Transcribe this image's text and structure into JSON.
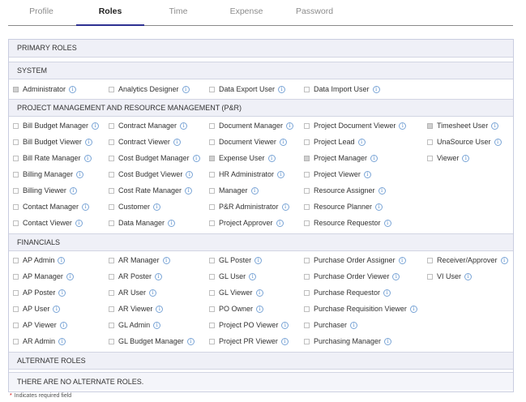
{
  "tabs": [
    "Profile",
    "Roles",
    "Time",
    "Expense",
    "Password"
  ],
  "active_tab": "Roles",
  "info_glyph": "i",
  "sections": {
    "primary_roles": "PRIMARY ROLES",
    "system": "SYSTEM",
    "pmrm": "PROJECT MANAGEMENT AND RESOURCE MANAGEMENT (P&R)",
    "financials": "FINANCIALS",
    "alternate_roles": "ALTERNATE ROLES",
    "no_alternate": "THERE ARE NO ALTERNATE ROLES."
  },
  "system_roles": [
    {
      "label": "Administrator",
      "checked": true
    },
    {
      "label": "Analytics Designer",
      "checked": false
    },
    {
      "label": "Data Export User",
      "checked": false
    },
    {
      "label": "Data Import User",
      "checked": false
    }
  ],
  "pmrm_columns": [
    [
      {
        "label": "Bill Budget Manager",
        "checked": false
      },
      {
        "label": "Bill Budget Viewer",
        "checked": false
      },
      {
        "label": "Bill Rate Manager",
        "checked": false
      },
      {
        "label": "Billing Manager",
        "checked": false
      },
      {
        "label": "Billing Viewer",
        "checked": false
      },
      {
        "label": "Contact Manager",
        "checked": false
      },
      {
        "label": "Contact Viewer",
        "checked": false
      }
    ],
    [
      {
        "label": "Contract Manager",
        "checked": false
      },
      {
        "label": "Contract Viewer",
        "checked": false
      },
      {
        "label": "Cost Budget Manager",
        "checked": false
      },
      {
        "label": "Cost Budget Viewer",
        "checked": false
      },
      {
        "label": "Cost Rate Manager",
        "checked": false
      },
      {
        "label": "Customer",
        "checked": false
      },
      {
        "label": "Data Manager",
        "checked": false
      }
    ],
    [
      {
        "label": "Document Manager",
        "checked": false
      },
      {
        "label": "Document Viewer",
        "checked": false
      },
      {
        "label": "Expense User",
        "checked": true
      },
      {
        "label": "HR Administrator",
        "checked": false
      },
      {
        "label": "Manager",
        "checked": false
      },
      {
        "label": "P&R Administrator",
        "checked": false
      },
      {
        "label": "Project Approver",
        "checked": false
      }
    ],
    [
      {
        "label": "Project Document Viewer",
        "checked": false
      },
      {
        "label": "Project Lead",
        "checked": false
      },
      {
        "label": "Project Manager",
        "checked": true
      },
      {
        "label": "Project Viewer",
        "checked": false
      },
      {
        "label": "Resource Assigner",
        "checked": false
      },
      {
        "label": "Resource Planner",
        "checked": false
      },
      {
        "label": "Resource Requestor",
        "checked": false
      }
    ],
    [
      {
        "label": "Timesheet User",
        "checked": true
      },
      {
        "label": "UnaSource User",
        "checked": false
      },
      {
        "label": "Viewer",
        "checked": false
      }
    ]
  ],
  "financial_columns": [
    [
      {
        "label": "AP Admin",
        "checked": false
      },
      {
        "label": "AP Manager",
        "checked": false
      },
      {
        "label": "AP Poster",
        "checked": false
      },
      {
        "label": "AP User",
        "checked": false
      },
      {
        "label": "AP Viewer",
        "checked": false
      },
      {
        "label": "AR Admin",
        "checked": false
      }
    ],
    [
      {
        "label": "AR Manager",
        "checked": false
      },
      {
        "label": "AR Poster",
        "checked": false
      },
      {
        "label": "AR User",
        "checked": false
      },
      {
        "label": "AR Viewer",
        "checked": false
      },
      {
        "label": "GL Admin",
        "checked": false
      },
      {
        "label": "GL Budget Manager",
        "checked": false
      }
    ],
    [
      {
        "label": "GL Poster",
        "checked": false
      },
      {
        "label": "GL User",
        "checked": false
      },
      {
        "label": "GL Viewer",
        "checked": false
      },
      {
        "label": "PO Owner",
        "checked": false
      },
      {
        "label": "Project PO Viewer",
        "checked": false
      },
      {
        "label": "Project PR Viewer",
        "checked": false
      }
    ],
    [
      {
        "label": "Purchase Order Assigner",
        "checked": false
      },
      {
        "label": "Purchase Order Viewer",
        "checked": false
      },
      {
        "label": "Purchase Requestor",
        "checked": false
      },
      {
        "label": "Purchase Requisition Viewer",
        "checked": false
      },
      {
        "label": "Purchaser",
        "checked": false
      },
      {
        "label": "Purchasing Manager",
        "checked": false
      }
    ],
    [
      {
        "label": "Receiver/Approver",
        "checked": false
      },
      {
        "label": "VI User",
        "checked": false
      }
    ]
  ],
  "required_note": {
    "star": "*",
    "text": "Indicates required field"
  }
}
